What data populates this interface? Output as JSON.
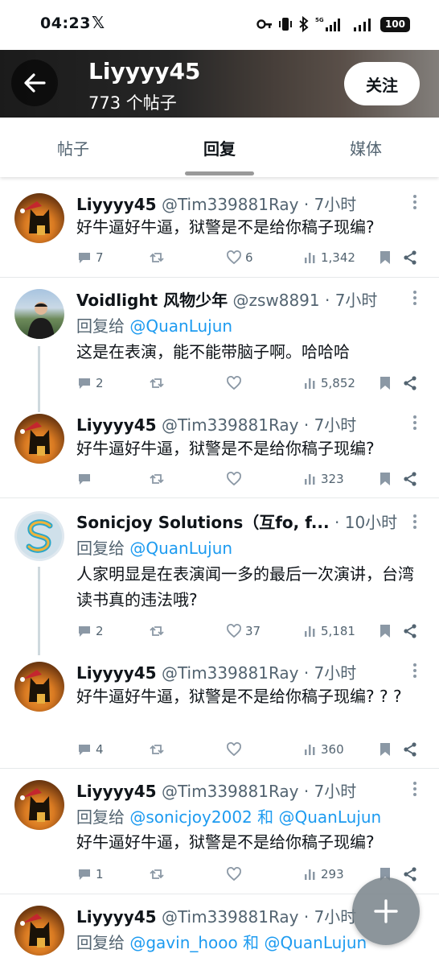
{
  "status_bar": {
    "time": "04:23",
    "x_logo": "𝕏",
    "battery": "100"
  },
  "header": {
    "name": "Liyyyy45",
    "post_count": "773 个帖子",
    "follow_label": "关注"
  },
  "tabs": [
    {
      "label": "帖子",
      "active": false
    },
    {
      "label": "回复",
      "active": true
    },
    {
      "label": "媒体",
      "active": false
    }
  ],
  "posts": [
    {
      "name": "Liyyyy45",
      "handle": "@Tim339881Ray · 7小时",
      "reply_to": null,
      "text": "好牛逼好牛逼，狱警是不是给你稿子现编?",
      "replies": "7",
      "reposts": "",
      "likes": "6",
      "views": "1,342"
    },
    {
      "name": "Voidlight 风物少年",
      "handle": "@zsw8891 · 7小时",
      "reply_prefix": "回复给",
      "reply_to": "@QuanLujun",
      "text": "这是在表演，能不能带脑子啊。哈哈哈",
      "replies": "2",
      "reposts": "",
      "likes": "",
      "views": "5,852"
    },
    {
      "name": "Liyyyy45",
      "handle": "@Tim339881Ray · 7小时",
      "reply_to": null,
      "text": "好牛逼好牛逼，狱警是不是给你稿子现编?",
      "replies": "",
      "reposts": "",
      "likes": "",
      "views": "323"
    },
    {
      "name": "Sonicjoy Solutions（互fo, f...",
      "handle": "· 10小时",
      "reply_prefix": "回复给",
      "reply_to": "@QuanLujun",
      "text": "人家明显是在表演闻一多的最后一次演讲，台湾读书真的违法哦?",
      "replies": "2",
      "reposts": "",
      "likes": "37",
      "views": "5,181"
    },
    {
      "name": "Liyyyy45",
      "handle": "@Tim339881Ray · 7小时",
      "reply_to": null,
      "text": "好牛逼好牛逼，狱警是不是给你稿子现编? ? ?",
      "replies": "4",
      "reposts": "",
      "likes": "",
      "views": "360"
    },
    {
      "name": "Liyyyy45",
      "handle": "@Tim339881Ray · 7小时",
      "reply_prefix": "回复给",
      "reply_to": "@sonicjoy2002",
      "reply_and": "和",
      "reply_to_2": "@QuanLujun",
      "text": "好牛逼好牛逼，狱警是不是给你稿子现编?",
      "replies": "1",
      "reposts": "",
      "likes": "",
      "views": "293"
    },
    {
      "name": "Liyyyy45",
      "handle": "@Tim339881Ray · 7小时",
      "reply_prefix": "回复给",
      "reply_to": "@gavin_hooo",
      "reply_and": "和",
      "reply_to_2": "@QuanLujun"
    }
  ],
  "fab_label": "+"
}
